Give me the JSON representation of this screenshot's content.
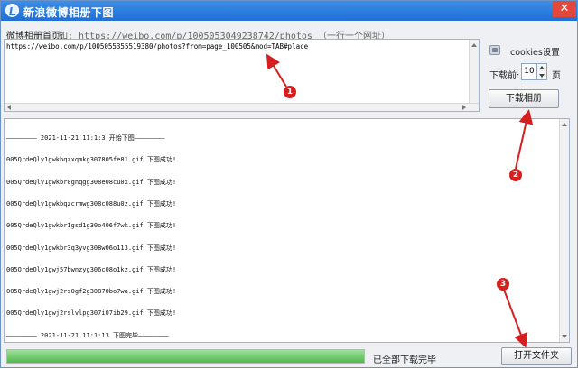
{
  "window": {
    "title": "新浪微博相册下图",
    "close_glyph": "✕"
  },
  "url_section": {
    "label": "微博相册首页:",
    "hint": "如: https://weibo.com/p/1005053049238742/photos （一行一个网址）",
    "value": "https://weibo.com/p/1005055355519380/photos?from=page_100505&mod=TAB#place"
  },
  "settings": {
    "cookie_label": "cookies设置",
    "pages_label": "下载前:",
    "pages_value": "10",
    "pages_unit": "页",
    "download_button": "下载相册"
  },
  "log": {
    "lines": [
      "———————— 2021-11-21 11:1:3 开始下图————————",
      "005QrdeQly1gwkbqzxqmkg307805fe81.gif 下图成功!",
      "005QrdeQly1gwkbr0gnqgg308e08cu0x.gif 下图成功!",
      "005QrdeQly1gwkbqzcrmwg308c088u0z.gif 下图成功!",
      "005QrdeQly1gwkbr1gsd1g30o406f7wk.gif 下图成功!",
      "005QrdeQly1gwkbr3q3yvg308w06o113.gif 下图成功!",
      "005QrdeQly1gwj57bwnzyg306c08o1kz.gif 下图成功!",
      "005QrdeQly1gwj2rs0gf2g30870bo7wa.gif 下图成功!",
      "005QrdeQly1gwj2rslvlpg307i07ib29.gif 下图成功!",
      "———————— 2021-11-21 11:1:13 下图完毕————————"
    ]
  },
  "status": {
    "progress": 1.0,
    "text": "已全部下载完毕",
    "open_folder_button": "打开文件夹"
  },
  "annotations": {
    "marker_1": "1",
    "marker_2": "2",
    "marker_3": "3",
    "color": "#d61f1f"
  }
}
